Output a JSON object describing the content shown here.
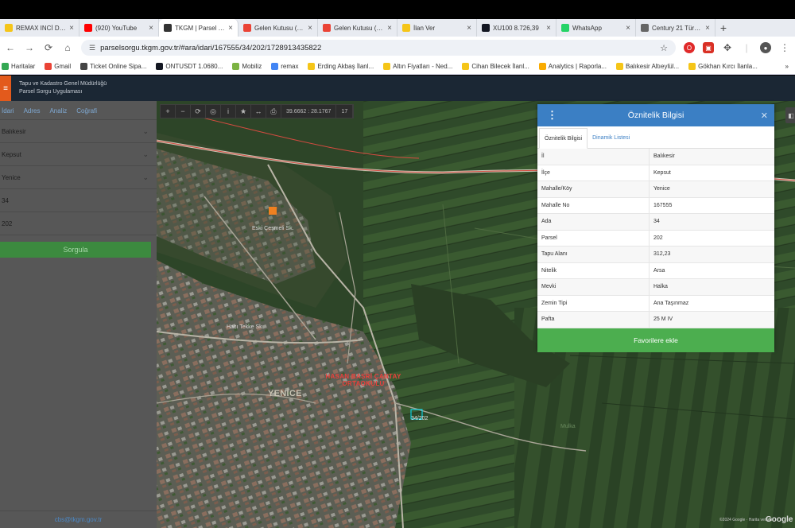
{
  "browser": {
    "tabs": [
      {
        "label": "REMAX INCİ DEN...",
        "icon": "s-favicon",
        "color": "#f5c518",
        "active": false
      },
      {
        "label": "(920) YouTube",
        "icon": "youtube-favicon",
        "color": "#ff0000",
        "active": false
      },
      {
        "label": "TKGM | Parsel Sc",
        "icon": "location-pin-favicon",
        "color": "#333333",
        "active": true
      },
      {
        "label": "Gelen Kutusu (1...",
        "icon": "gmail-favicon",
        "color": "#ea4335",
        "active": false
      },
      {
        "label": "Gelen Kutusu (30...",
        "icon": "gmail-favicon",
        "color": "#ea4335",
        "active": false
      },
      {
        "label": "İlan Ver",
        "icon": "s-favicon",
        "color": "#f5c518",
        "active": false
      },
      {
        "label": "XU100 8.726,39",
        "icon": "tradingview-favicon",
        "color": "#131722",
        "active": false
      },
      {
        "label": "WhatsApp",
        "icon": "whatsapp-favicon",
        "color": "#25d366",
        "active": false
      },
      {
        "label": "Century 21 Türki...",
        "icon": "globe-favicon",
        "color": "#666666",
        "active": false
      }
    ],
    "new_tab": "+",
    "url": "parselsorgu.tkgm.gov.tr/#ara/idari/167555/34/202/1728913435822",
    "bookmarks": [
      {
        "label": "Haritalar",
        "color": "#34a853"
      },
      {
        "label": "Gmail",
        "color": "#ea4335"
      },
      {
        "label": "Ticket Online Sipa...",
        "color": "#444444"
      },
      {
        "label": "ONTUSDT 1.0680...",
        "color": "#131722"
      },
      {
        "label": "Mobiliz",
        "color": "#7cb342"
      },
      {
        "label": "remax",
        "color": "#4285f4"
      },
      {
        "label": "Erding Akbaş İlanl...",
        "color": "#f5c518"
      },
      {
        "label": "Altın Fiyatları - Ned...",
        "color": "#f5c518"
      },
      {
        "label": "Cihan Bilecek İlanl...",
        "color": "#f5c518"
      },
      {
        "label": "Analytics | Raporla...",
        "color": "#f9ab00"
      },
      {
        "label": "Balıkesir Altıeylül...",
        "color": "#f5c518"
      },
      {
        "label": "Gökhan Kırcı İlanla...",
        "color": "#f5c518"
      }
    ],
    "bookmarks_more": "»"
  },
  "app": {
    "title_line1": "Tapu ve Kadastro Genel Müdürlüğü",
    "title_line2": "Parsel Sorgu Uygulaması"
  },
  "sidebar": {
    "tabs": [
      "İdari",
      "Adres",
      "Analiz",
      "Coğrafi"
    ],
    "fields": [
      {
        "value": "Balıkesir",
        "type": "select"
      },
      {
        "value": "Kepsut",
        "type": "select"
      },
      {
        "value": "Yenice",
        "type": "select"
      },
      {
        "value": "34",
        "type": "input"
      },
      {
        "value": "202",
        "type": "input"
      }
    ],
    "query_button": "Sorgula",
    "footer_email": "cbs@tkgm.gov.tr"
  },
  "map": {
    "coord_readout": "39.6662 : 28.1767",
    "zoom": "17",
    "labels": {
      "school": "HASAN BASRİ ÇANTAY ORTAOKULU",
      "village": "YENİCE",
      "poi1": "Eski Çeşmeli Sk.",
      "poi2": "Hacı Tekke Sk.",
      "parcel": "34/202",
      "field_label": "Mulka"
    },
    "copyright": "©2024 Google · Harita verileri",
    "logo": "Google"
  },
  "attribute_panel": {
    "title": "Öznitelik Bilgisi",
    "tabs": [
      "Öznitelik Bilgisi",
      "Dinamik Listesi"
    ],
    "rows": [
      {
        "key": "İl",
        "value": "Balıkesir"
      },
      {
        "key": "İlçe",
        "value": "Kepsut"
      },
      {
        "key": "Mahalle/Köy",
        "value": "Yenice"
      },
      {
        "key": "Mahalle No",
        "value": "167555"
      },
      {
        "key": "Ada",
        "value": "34"
      },
      {
        "key": "Parsel",
        "value": "202"
      },
      {
        "key": "Tapu Alanı",
        "value": "312,23"
      },
      {
        "key": "Nitelik",
        "value": "Arsa"
      },
      {
        "key": "Mevki",
        "value": "Halka"
      },
      {
        "key": "Zemin Tipi",
        "value": "Ana Taşınmaz"
      },
      {
        "key": "Pafta",
        "value": "25 M IV"
      }
    ],
    "favorite_button": "Favorilere ekle"
  }
}
